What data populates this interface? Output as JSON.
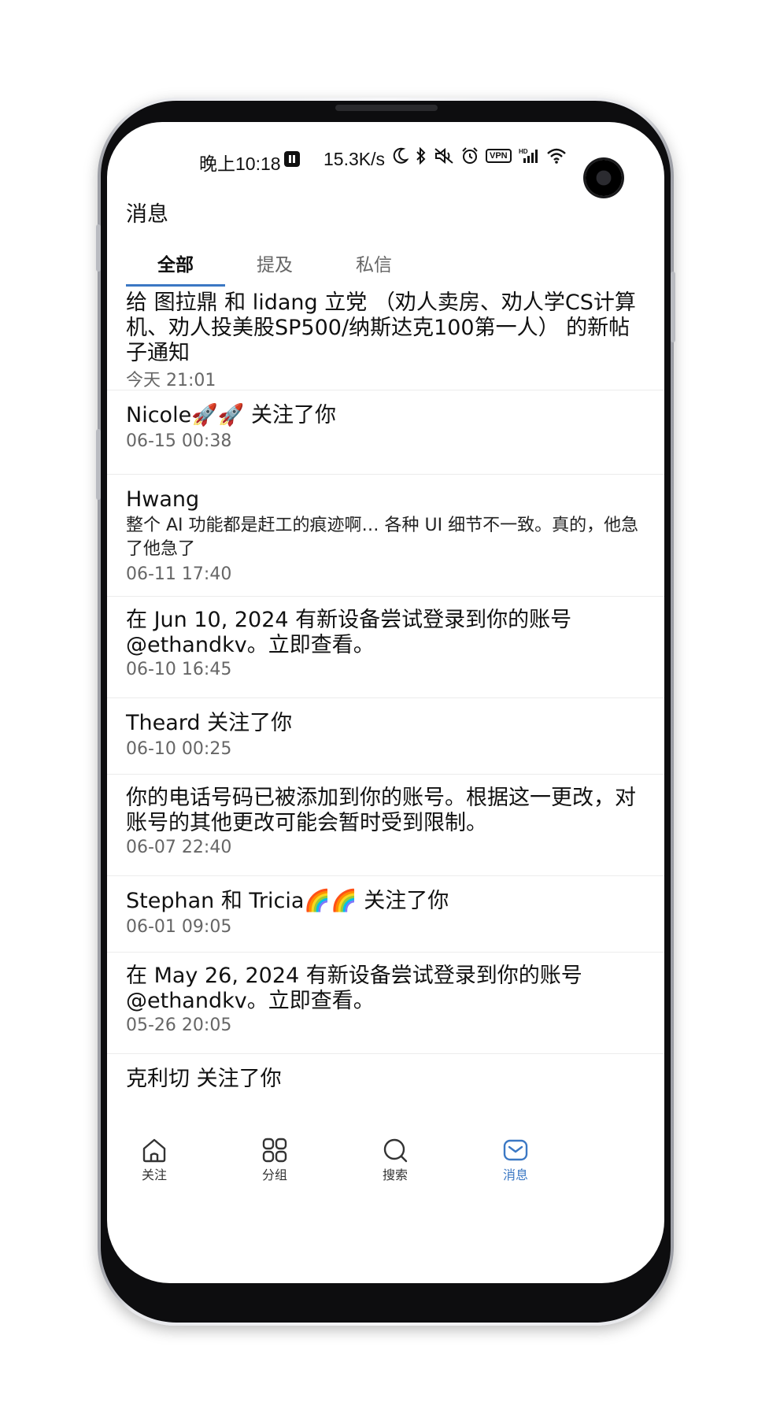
{
  "status_bar": {
    "time": "晚上10:18",
    "network_speed": "15.3K/s",
    "vpn": "VPN",
    "hd": "HD",
    "icons": [
      "pause-icon",
      "moon-icon",
      "bluetooth-icon",
      "mute-icon",
      "alarm-icon",
      "vpn-icon",
      "signal-icon",
      "wifi-icon",
      "battery-icon"
    ]
  },
  "header": {
    "title": "消息"
  },
  "tabs": [
    {
      "label": "全部",
      "active": true
    },
    {
      "label": "提及",
      "active": false
    },
    {
      "label": "私信",
      "active": false
    }
  ],
  "notifications": [
    {
      "title": "给 图拉鼎 和 lidang 立党 （劝人卖房、劝人学CS计算机、劝人投美股SP500/纳斯达克100第一人） 的新帖子通知",
      "body": "",
      "time": "今天 21:01"
    },
    {
      "title": "Nicole🚀🚀 关注了你",
      "body": "",
      "time": "06-15 00:38"
    },
    {
      "title": "Hwang",
      "body": "整个 AI 功能都是赶工的痕迹啊… 各种 UI  细节不一致。真的，他急了他急了",
      "time": "06-11 17:40"
    },
    {
      "title": "在 Jun 10, 2024 有新设备尝试登录到你的账号 @ethandkv。立即查看。",
      "body": "",
      "time": "06-10 16:45"
    },
    {
      "title": "Theard 关注了你",
      "body": "",
      "time": "06-10 00:25"
    },
    {
      "title": "你的电话号码已被添加到你的账号。根据这一更改，对账号的其他更改可能会暂时受到限制。",
      "body": "",
      "time": "06-07 22:40"
    },
    {
      "title": "Stephan 和 Tricia🌈🌈 关注了你",
      "body": "",
      "time": "06-01 09:05"
    },
    {
      "title": "在 May 26, 2024 有新设备尝试登录到你的账号 @ethandkv。立即查看。",
      "body": "",
      "time": "05-26 20:05"
    },
    {
      "title": "克利切 关注了你",
      "body": "",
      "time": ""
    }
  ],
  "bottom_nav": [
    {
      "label": "关注",
      "icon": "home-icon",
      "active": false
    },
    {
      "label": "分组",
      "icon": "grid-icon",
      "active": false
    },
    {
      "label": "搜索",
      "icon": "search-icon",
      "active": false
    },
    {
      "label": "消息",
      "icon": "message-icon",
      "active": true
    }
  ],
  "colors": {
    "accent": "#3b78c4",
    "text": "#111111",
    "secondary_text": "#666666",
    "divider": "#ececec"
  }
}
